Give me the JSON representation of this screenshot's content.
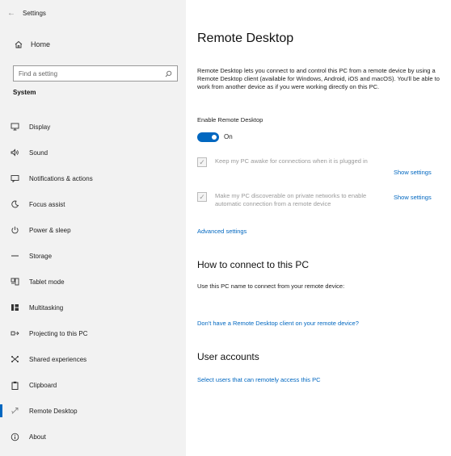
{
  "window": {
    "back_glyph": "←",
    "title": "Settings"
  },
  "sidebar": {
    "home_label": "Home",
    "search_placeholder": "Find a setting",
    "section_label": "System",
    "items": [
      {
        "label": "Display",
        "icon": "display-icon"
      },
      {
        "label": "Sound",
        "icon": "sound-icon"
      },
      {
        "label": "Notifications & actions",
        "icon": "notifications-icon"
      },
      {
        "label": "Focus assist",
        "icon": "focus-assist-icon"
      },
      {
        "label": "Power & sleep",
        "icon": "power-icon"
      },
      {
        "label": "Storage",
        "icon": "storage-icon"
      },
      {
        "label": "Tablet mode",
        "icon": "tablet-mode-icon"
      },
      {
        "label": "Multitasking",
        "icon": "multitasking-icon"
      },
      {
        "label": "Projecting to this PC",
        "icon": "projecting-icon"
      },
      {
        "label": "Shared experiences",
        "icon": "shared-experiences-icon"
      },
      {
        "label": "Clipboard",
        "icon": "clipboard-icon"
      },
      {
        "label": "Remote Desktop",
        "icon": "remote-desktop-icon",
        "active": true
      },
      {
        "label": "About",
        "icon": "about-icon"
      }
    ]
  },
  "main": {
    "title": "Remote Desktop",
    "description": "Remote Desktop lets you connect to and control this PC from a remote device by using a Remote Desktop client (available for Windows, Android, iOS and macOS). You'll be able to work from another device as if you were working directly on this PC.",
    "enable_label": "Enable Remote Desktop",
    "toggle_state": "On",
    "toggle_on": true,
    "option1_text": "Keep my PC awake for connections when it is plugged in",
    "option2_text": "Make my PC discoverable on private networks to enable automatic connection from a remote device",
    "show_settings": "Show settings",
    "advanced_settings": "Advanced settings",
    "connect_heading": "How to connect to this PC",
    "connect_text": "Use this PC name to connect from your remote device:",
    "no_client_link": "Don't have a Remote Desktop client on your remote device?",
    "user_accounts_heading": "User accounts",
    "select_users_link": "Select users that can remotely access this PC"
  },
  "colors": {
    "accent": "#0067c0",
    "sidebar_bg": "#f2f2f2"
  }
}
